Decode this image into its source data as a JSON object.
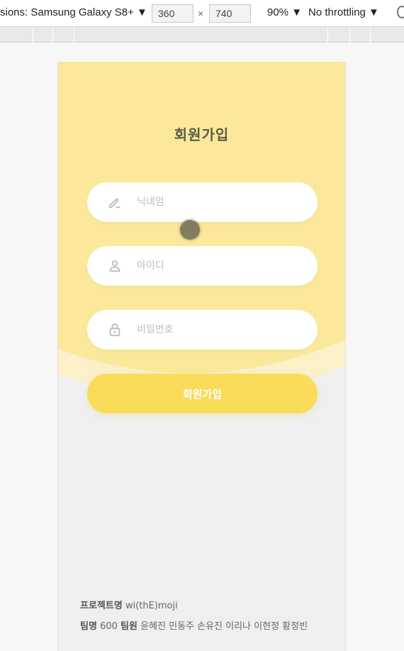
{
  "devtools": {
    "device": "sions: Samsung Galaxy S8+ ▼",
    "width": "360",
    "times": "×",
    "height": "740",
    "zoom": "90% ▼",
    "throttling": "No throttling ▼"
  },
  "signup": {
    "title": "회원가입",
    "nickname_placeholder": "닉네임",
    "id_placeholder": "아이디",
    "password_placeholder": "비밀번호",
    "submit_label": "회원가입"
  },
  "footer": {
    "project_label": "프로젝트명",
    "project_value": "wi(thE)moji",
    "team_label": "팀명",
    "team_value": "600",
    "members_label": "팀원",
    "members_value": "윤혜진 민동주 손유진 이리나 이현정 황정빈"
  },
  "colors": {
    "header_yellow": "#fbe89a",
    "button_yellow": "#f9dc5a",
    "background": "#efefef"
  },
  "icons": {
    "nickname": "pencil-icon",
    "id": "person-icon",
    "password": "lock-icon"
  }
}
